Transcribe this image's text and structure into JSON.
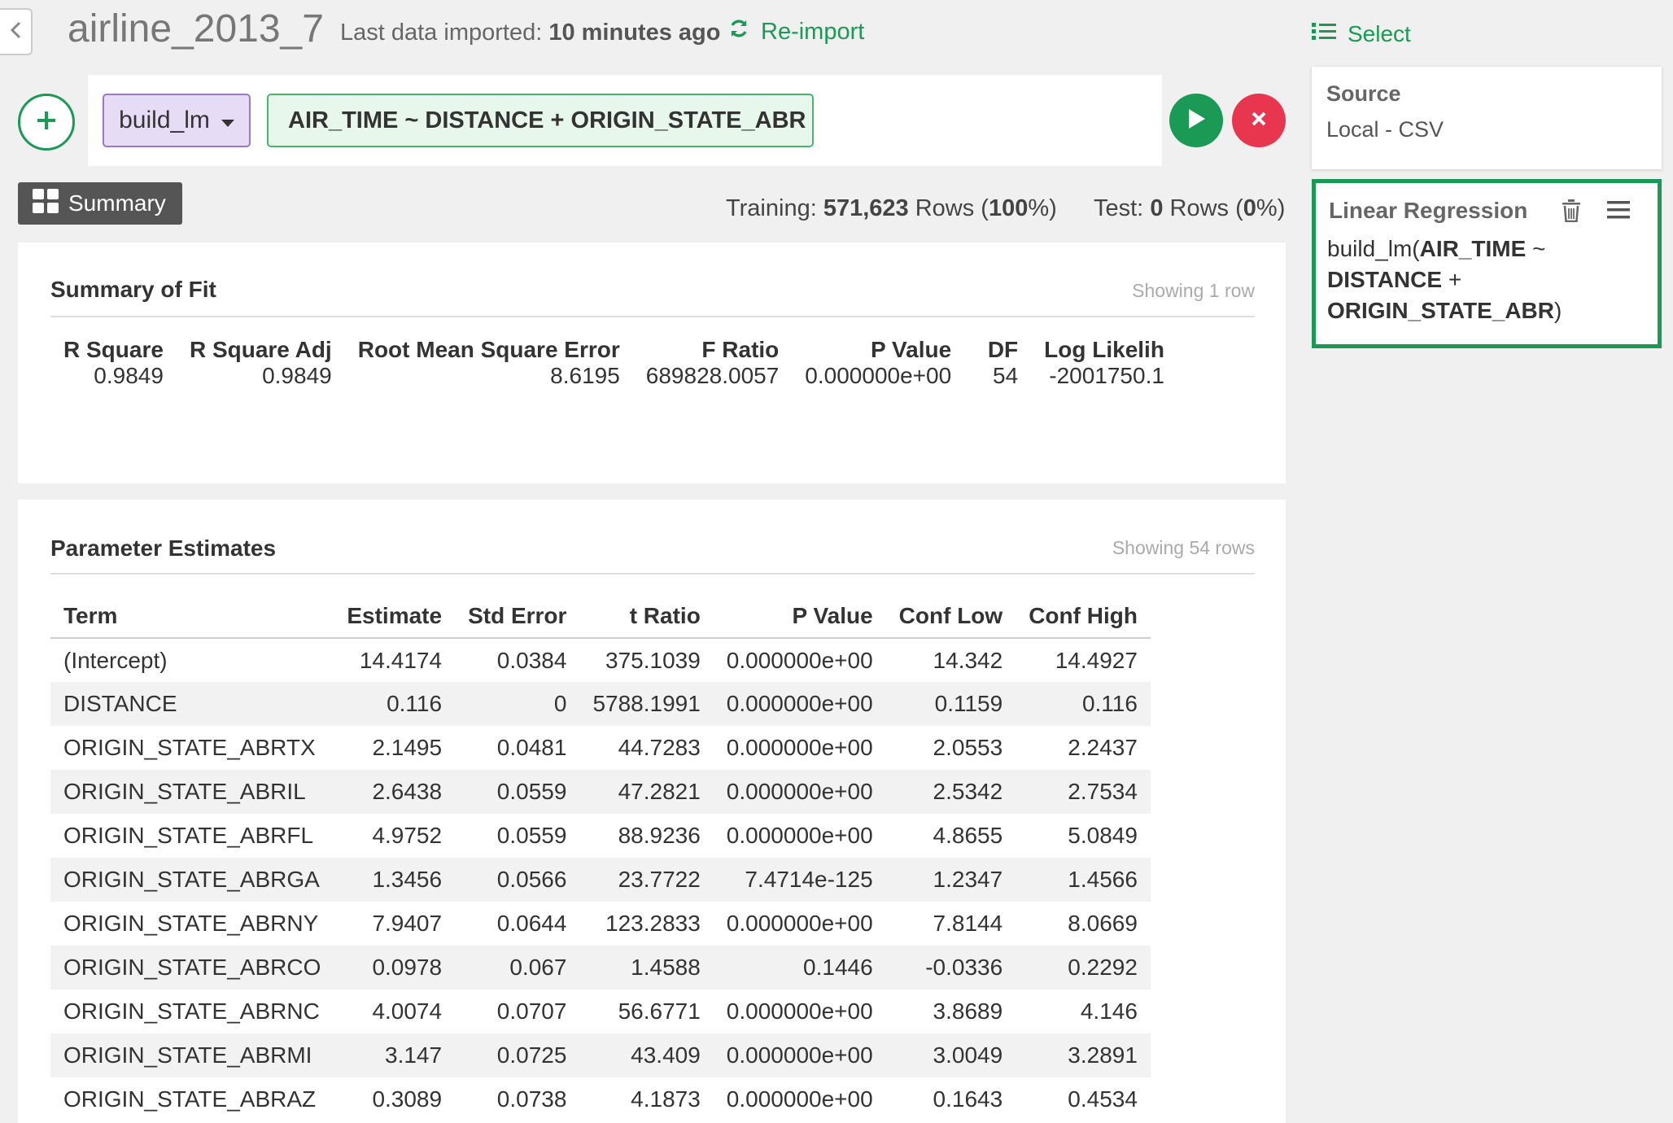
{
  "header": {
    "title": "airline_2013_7",
    "import_label": "Last data imported:",
    "import_time": "10 minutes ago",
    "reimport_label": "Re-import"
  },
  "command": {
    "function_label": "build_lm",
    "formula": "AIR_TIME ~ DISTANCE + ORIGIN_STATE_ABR"
  },
  "tabs": {
    "summary_label": "Summary"
  },
  "stats": {
    "training_label": "Training:",
    "training_rows": "571,623",
    "training_rows_word": "Rows",
    "training_pct_open": "(",
    "training_pct": "100",
    "training_pct_close": "%)",
    "test_label": "Test:",
    "test_rows": "0",
    "test_rows_word": "Rows",
    "test_pct_open": "(",
    "test_pct": "0",
    "test_pct_close": "%)"
  },
  "summary_of_fit": {
    "title": "Summary of Fit",
    "showing": "Showing 1 row",
    "headers": [
      "R Square",
      "R Square Adj",
      "Root Mean Square Error",
      "F Ratio",
      "P Value",
      "DF",
      "Log Likelih"
    ],
    "row": [
      "0.9849",
      "0.9849",
      "8.6195",
      "689828.0057",
      "0.000000e+00",
      "54",
      "-2001750.1"
    ]
  },
  "parameter_estimates": {
    "title": "Parameter Estimates",
    "showing": "Showing 54 rows",
    "headers": [
      "Term",
      "Estimate",
      "Std Error",
      "t Ratio",
      "P Value",
      "Conf Low",
      "Conf High"
    ],
    "rows": [
      [
        "(Intercept)",
        "14.4174",
        "0.0384",
        "375.1039",
        "0.000000e+00",
        "14.342",
        "14.4927"
      ],
      [
        "DISTANCE",
        "0.116",
        "0",
        "5788.1991",
        "0.000000e+00",
        "0.1159",
        "0.116"
      ],
      [
        "ORIGIN_STATE_ABRTX",
        "2.1495",
        "0.0481",
        "44.7283",
        "0.000000e+00",
        "2.0553",
        "2.2437"
      ],
      [
        "ORIGIN_STATE_ABRIL",
        "2.6438",
        "0.0559",
        "47.2821",
        "0.000000e+00",
        "2.5342",
        "2.7534"
      ],
      [
        "ORIGIN_STATE_ABRFL",
        "4.9752",
        "0.0559",
        "88.9236",
        "0.000000e+00",
        "4.8655",
        "5.0849"
      ],
      [
        "ORIGIN_STATE_ABRGA",
        "1.3456",
        "0.0566",
        "23.7722",
        "7.4714e-125",
        "1.2347",
        "1.4566"
      ],
      [
        "ORIGIN_STATE_ABRNY",
        "7.9407",
        "0.0644",
        "123.2833",
        "0.000000e+00",
        "7.8144",
        "8.0669"
      ],
      [
        "ORIGIN_STATE_ABRCO",
        "0.0978",
        "0.067",
        "1.4588",
        "0.1446",
        "-0.0336",
        "0.2292"
      ],
      [
        "ORIGIN_STATE_ABRNC",
        "4.0074",
        "0.0707",
        "56.6771",
        "0.000000e+00",
        "3.8689",
        "4.146"
      ],
      [
        "ORIGIN_STATE_ABRMI",
        "3.147",
        "0.0725",
        "43.409",
        "0.000000e+00",
        "3.0049",
        "3.2891"
      ],
      [
        "ORIGIN_STATE_ABRAZ",
        "0.3089",
        "0.0738",
        "4.1873",
        "0.000000e+00",
        "0.1643",
        "0.4534"
      ]
    ]
  },
  "right_panel": {
    "select_label": "Select",
    "source_title": "Source",
    "source_value": "Local - CSV",
    "step_title": "Linear Regression",
    "step_fn": "build_lm(",
    "step_arg1": "AIR_TIME",
    "step_tilde": " ~",
    "step_arg2": "DISTANCE",
    "step_plus": " +",
    "step_arg3": "ORIGIN_STATE_ABR",
    "step_close": ")"
  },
  "colors": {
    "accent_green": "#1a9a55",
    "cancel_red": "#e8364f",
    "function_pill_bg": "#e7dcf5",
    "formula_pill_bg": "#e8f7ec"
  },
  "icons": [
    "chevron-left-icon",
    "refresh-icon",
    "plus-icon",
    "caret-down-icon",
    "play-icon",
    "close-icon",
    "grid-icon",
    "list-icon",
    "trash-icon",
    "hamburger-icon"
  ]
}
